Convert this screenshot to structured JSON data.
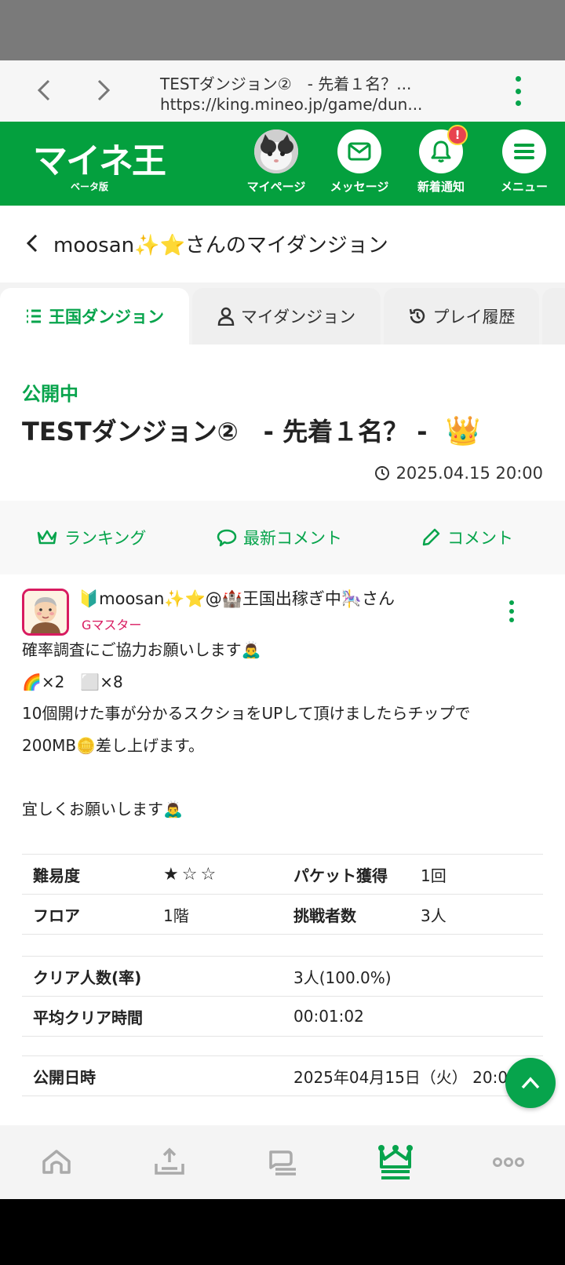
{
  "browser": {
    "tab_title": "TESTダンジョン②　- 先着１名？...",
    "url": "https://king.mineo.jp/game/dun..."
  },
  "header": {
    "logo": "マイネ王",
    "logo_sub": "ベータ版",
    "items": [
      {
        "label": "マイページ",
        "icon": "avatar-cat"
      },
      {
        "label": "メッセージ",
        "icon": "mail-icon"
      },
      {
        "label": "新着通知",
        "icon": "bell-icon",
        "badge": "!"
      },
      {
        "label": "メニュー",
        "icon": "hamburger-icon"
      }
    ]
  },
  "page": {
    "title": "moosan✨⭐さんのマイダンジョン"
  },
  "tabs": [
    {
      "label": "王国ダンジョン",
      "icon": "list-icon",
      "active": true
    },
    {
      "label": "マイダンジョン",
      "icon": "person-icon",
      "active": false
    },
    {
      "label": "プレイ履歴",
      "icon": "history-icon",
      "active": false
    }
  ],
  "dungeon": {
    "status": "公開中",
    "title": "TESTダンジョン②　- 先着１名？ -",
    "crown": "👑",
    "datetime": "2025.04.15 20:00"
  },
  "actions": {
    "ranking": "ランキング",
    "latest_comment": "最新コメント",
    "comment": "コメント"
  },
  "post": {
    "author": "🔰moosan✨⭐@🏰王国出稼ぎ中🎠さん",
    "rank": "Gマスター",
    "lines": [
      "確率調査にご協力お願いします🙇‍♂️",
      "🌈×2　⬜×8",
      "10個開けた事が分かるスクショをUPして頂けましたらチップで",
      "200MB🪙差し上げます。",
      "",
      "宜しくお願いします🙇‍♂️"
    ]
  },
  "info": {
    "difficulty_label": "難易度",
    "difficulty_stars": "★☆☆",
    "difficulty_value": 1,
    "packet_label": "パケット獲得",
    "packet_value": "1回",
    "floor_label": "フロア",
    "floor_value": "1階",
    "challengers_label": "挑戦者数",
    "challengers_value": "3人",
    "clear_label": "クリア人数(率)",
    "clear_value": "3人(100.0%)",
    "avg_time_label": "平均クリア時間",
    "avg_time_value": "00:01:02",
    "published_label": "公開日時",
    "published_value": "2025年04月15日（火） 20:00"
  },
  "bottom_nav": [
    {
      "icon": "home-icon",
      "active": false
    },
    {
      "icon": "upload-tray-icon",
      "active": false
    },
    {
      "icon": "chat-bubbles-icon",
      "active": false
    },
    {
      "icon": "king-crown-icon",
      "active": true
    },
    {
      "icon": "more-icon",
      "active": false
    }
  ],
  "colors": {
    "brand_green": "#04a03e",
    "accent_green": "#07a44c",
    "rank_pink": "#d81b60",
    "badge_red": "#e8434f"
  }
}
